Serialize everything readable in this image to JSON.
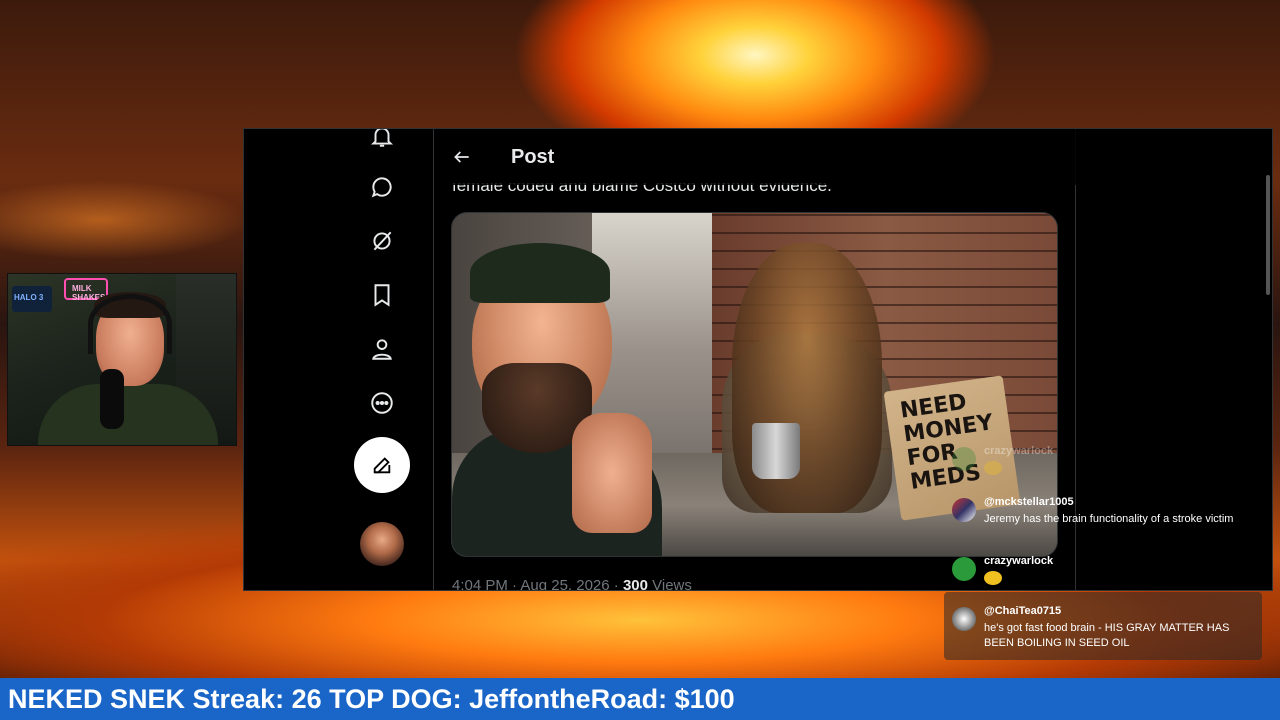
{
  "post": {
    "title": "Post",
    "text": "female coded and blame Costco without evidence.",
    "timestamp": "4:04 PM · Aug 25, 2026 · ",
    "views_count": "300",
    "views_label": " Views",
    "image_sign_text": "NEED\nMONEY\nFOR\nMEDS"
  },
  "nav": {
    "icons": [
      "notifications-icon",
      "messages-icon",
      "grok-icon",
      "bookmarks-icon",
      "profile-icon",
      "more-icon"
    ],
    "compose_icon": "compose-icon"
  },
  "webcam": {
    "sign_left": "HALO 3",
    "sign_right": "MILK SHAKES"
  },
  "chat": {
    "messages": [
      {
        "user": "crazywarlock",
        "body": "",
        "emoji": true,
        "faded": true
      },
      {
        "user": "@mckstellar1005",
        "body": "Jeremy has the brain functionality of a stroke victim",
        "emoji": false,
        "faded": false
      },
      {
        "user": "crazywarlock",
        "body": "",
        "emoji": true,
        "faded": false
      },
      {
        "user": "@ChaiTea0715",
        "body": "he's got fast food brain - HIS GRAY MATTER HAS BEEN BOILING IN SEED OIL",
        "emoji": false,
        "faded": false
      }
    ]
  },
  "ticker": {
    "text": "NEKED SNEK Streak: 26 TOP DOG: JeffontheRoad: $100"
  },
  "colors": {
    "ticker_bg": "#1a66c8",
    "x_text": "#e7e9ea",
    "x_muted": "#71767b",
    "x_border": "#2f3336"
  }
}
